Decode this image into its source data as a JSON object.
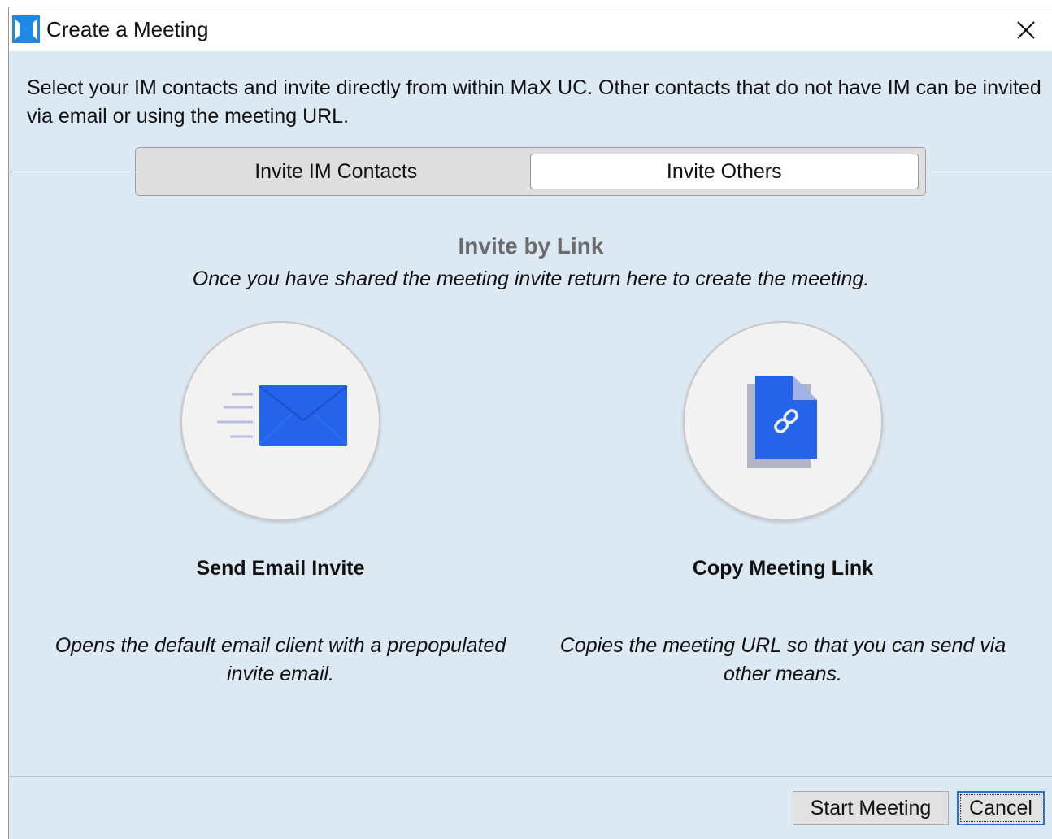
{
  "window": {
    "title": "Create a Meeting",
    "app_icon": "maxuc-logo-icon",
    "close_icon": "close-icon"
  },
  "intro": {
    "text": "Select your IM contacts and invite directly from within MaX UC.  Other contacts that do not have IM can be invited via email or using the meeting URL."
  },
  "tabs": [
    {
      "label": "Invite IM Contacts",
      "active": false
    },
    {
      "label": "Invite Others",
      "active": true
    }
  ],
  "section": {
    "title": "Invite by Link",
    "subtitle": "Once you have shared the meeting invite return here to create the meeting."
  },
  "options": {
    "email": {
      "icon": "email-icon",
      "title": "Send Email Invite",
      "description": "Opens the default email client with a prepopulated invite email."
    },
    "link": {
      "icon": "link-document-icon",
      "title": "Copy Meeting Link",
      "description": "Copies the meeting URL so that you can send via other means."
    }
  },
  "buttons": {
    "start": "Start Meeting",
    "cancel": "Cancel"
  },
  "colors": {
    "accent_blue": "#2563eb",
    "panel_bg": "#dce9f3",
    "title_gray": "#6b6b6b"
  }
}
